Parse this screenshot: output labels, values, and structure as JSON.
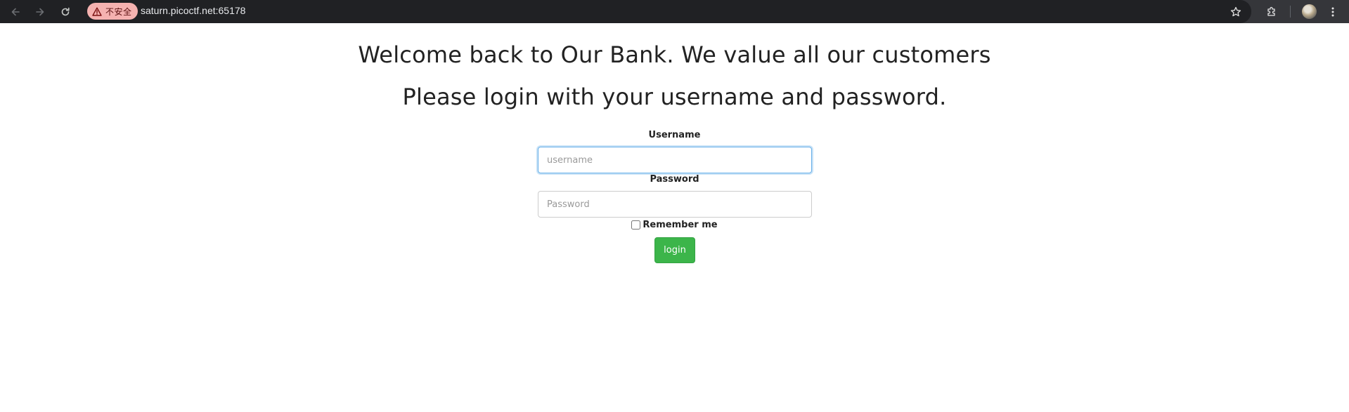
{
  "browser": {
    "security_chip_label": "不安全",
    "url": "saturn.picoctf.net:65178",
    "icons": {
      "back": "arrow-left-icon",
      "forward": "arrow-right-icon",
      "reload": "reload-icon",
      "warning": "warning-triangle-icon",
      "bookmark": "star-icon",
      "extensions": "puzzle-icon",
      "profile": "avatar",
      "menu": "kebab-menu-icon"
    }
  },
  "page": {
    "heading_1": "Welcome back to Our Bank. We value all our customers",
    "heading_2": "Please login with your username and password.",
    "form": {
      "username_label": "Username",
      "username_placeholder": "username",
      "password_label": "Password",
      "password_placeholder": "Password",
      "remember_label": "Remember me",
      "remember_checked": false,
      "login_label": "login"
    }
  },
  "colors": {
    "login_button": "#3cb54a",
    "focus_ring": "#66afe9",
    "security_chip_bg": "#f5b2b0",
    "toolbar_bg": "#202124"
  }
}
